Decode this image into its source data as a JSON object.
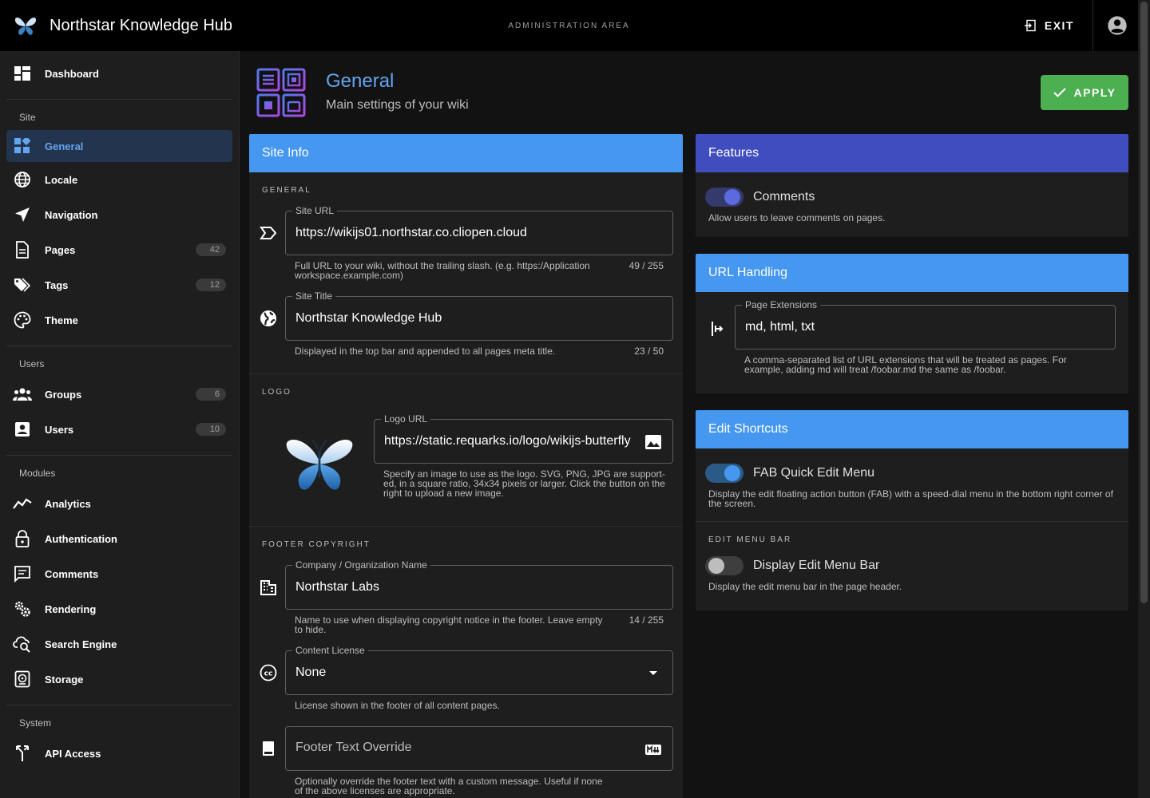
{
  "app": {
    "title": "Northstar Knowledge Hub",
    "admin_area": "ADMINISTRATION AREA",
    "exit_label": "EXIT"
  },
  "sidebar": {
    "items": [
      {
        "label": "Dashboard"
      },
      {
        "label": "General"
      },
      {
        "label": "Locale"
      },
      {
        "label": "Navigation"
      },
      {
        "label": "Pages",
        "badge": "42"
      },
      {
        "label": "Tags",
        "badge": "12"
      },
      {
        "label": "Theme"
      },
      {
        "label": "Groups",
        "badge": "6"
      },
      {
        "label": "Users",
        "badge": "10"
      },
      {
        "label": "Analytics"
      },
      {
        "label": "Authentication"
      },
      {
        "label": "Comments"
      },
      {
        "label": "Rendering"
      },
      {
        "label": "Search Engine"
      },
      {
        "label": "Storage"
      },
      {
        "label": "API Access"
      }
    ],
    "headers": {
      "site": "Site",
      "users": "Users",
      "modules": "Modules",
      "system": "System"
    }
  },
  "page": {
    "title": "General",
    "subtitle": "Main settings of your wiki",
    "apply_label": "APPLY"
  },
  "site_info": {
    "title": "Site Info",
    "general_label": "GENERAL",
    "site_url": {
      "label": "Site URL",
      "value": "https://wikijs01.northstar.co.cliopen.cloud",
      "hint": "Full URL to your wiki, without the trailing slash. (e.g. https:/Application workspace.example.com)",
      "count": "49 / 255"
    },
    "site_title": {
      "label": "Site Title",
      "value": "Northstar Knowledge Hub",
      "hint": "Displayed in the top bar and appended to all pages meta title.",
      "count": "23 / 50"
    },
    "logo_label": "LOGO",
    "logo_url": {
      "label": "Logo URL",
      "value": "https://static.requarks.io/logo/wikijs-butterfly",
      "hint": "Specify an image to use as the logo. SVG, PNG, JPG are support-ed, in a square ratio, 34x34 pixels or larger. Click the button on the right to upload a new image."
    },
    "footer_label": "FOOTER COPYRIGHT",
    "company": {
      "label": "Company / Organization Name",
      "value": "Northstar Labs",
      "hint": "Name to use when displaying copyright notice in the footer. Leave empty to hide.",
      "count": "14 / 255"
    },
    "license": {
      "label": "Content License",
      "value": "None",
      "hint": "License shown in the footer of all content pages."
    },
    "footer_override": {
      "placeholder": "Footer Text Override",
      "hint": "Optionally override the footer text with a custom message. Useful if none of the above licenses are appropriate."
    }
  },
  "features": {
    "title": "Features",
    "comments": {
      "label": "Comments",
      "hint": "Allow users to leave comments on pages.",
      "enabled": true
    }
  },
  "url_handling": {
    "title": "URL Handling",
    "page_extensions": {
      "label": "Page Extensions",
      "value": "md, html, txt",
      "hint": "A comma-separated list of URL extensions that will be treated as pages. For example, adding md will treat /foobar.md the same as /foobar."
    }
  },
  "edit_shortcuts": {
    "title": "Edit Shortcuts",
    "fab": {
      "label": "FAB Quick Edit Menu",
      "hint": "Display the edit floating action button (FAB) with a speed-dial menu in the bottom right corner of the screen.",
      "enabled": true
    },
    "menu_bar_label": "EDIT MENU BAR",
    "menu_bar": {
      "label": "Display Edit Menu Bar",
      "hint": "Display the edit menu bar in the page header.",
      "enabled": false
    }
  },
  "colors": {
    "accent": "#4597f0",
    "indigo": "#3f4dbf",
    "success": "#4caf50",
    "sidebar_active_bg": "#22344e"
  },
  "icons": {
    "app_logo": "butterfly-icon",
    "exit": "exit-icon",
    "account": "account-circle-icon"
  }
}
